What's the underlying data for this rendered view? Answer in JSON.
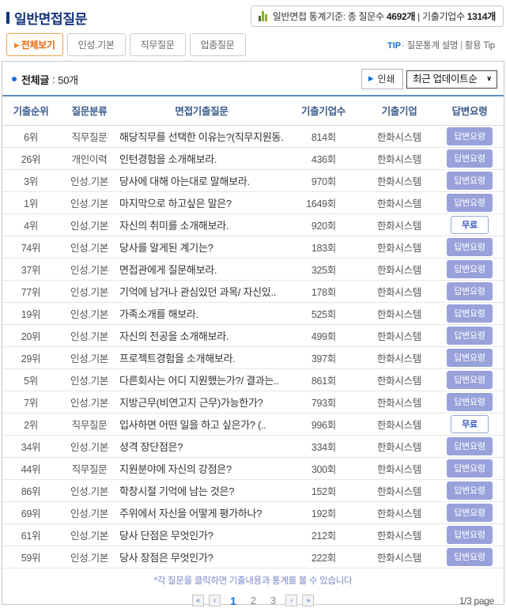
{
  "header": {
    "title": "일반면접질문",
    "stats": {
      "icon": "bar-chart-icon",
      "prefix": "일반면접 통계기준: 총 질문수",
      "question_count": "4692개",
      "separator": "|",
      "mid_label": "기출기업수",
      "company_count": "1314개"
    }
  },
  "tabs": [
    {
      "label": "전체보기",
      "active": true
    },
    {
      "label": "인성.기본",
      "active": false
    },
    {
      "label": "직무질문",
      "active": false
    },
    {
      "label": "업종질문",
      "active": false
    }
  ],
  "tip": {
    "label": "TIP",
    "bullet": "·",
    "link1": "질문통계 설명",
    "separator": "|",
    "link2": "활용 Tip"
  },
  "toolbar": {
    "total_label": "전체글",
    "colon": ":",
    "total_count": "50개",
    "print_label": "인쇄",
    "print_arrow": "▶",
    "sort_selected": "최근 업데이트순"
  },
  "table": {
    "columns": [
      "기출순위",
      "질문분류",
      "면접기출질문",
      "기출기업수",
      "기출기업",
      "답변요령"
    ],
    "rows": [
      {
        "rank": "6위",
        "category": "직무질문",
        "question": "해당직무를 선택한 이유는?(직무지원동..",
        "count": "814회",
        "company": "한화시스템",
        "action": "답변요령",
        "action_type": "badge"
      },
      {
        "rank": "26위",
        "category": "개인이력",
        "question": "인턴경험을 소개해보라.",
        "count": "436회",
        "company": "한화시스템",
        "action": "답변요령",
        "action_type": "badge"
      },
      {
        "rank": "3위",
        "category": "인성.기본",
        "question": "당사에 대해 아는대로 말해보라.",
        "count": "970회",
        "company": "한화시스템",
        "action": "답변요령",
        "action_type": "badge"
      },
      {
        "rank": "1위",
        "category": "인성.기본",
        "question": "마지막으로 하고싶은 말은?",
        "count": "1649회",
        "company": "한화시스템",
        "action": "답변요령",
        "action_type": "badge"
      },
      {
        "rank": "4위",
        "category": "인성.기본",
        "question": "자신의 취미를 소개해보라.",
        "count": "920회",
        "company": "한화시스템",
        "action": "무료",
        "action_type": "free"
      },
      {
        "rank": "74위",
        "category": "인성.기본",
        "question": "당사를 알게된 계기는?",
        "count": "183회",
        "company": "한화시스템",
        "action": "답변요령",
        "action_type": "badge"
      },
      {
        "rank": "37위",
        "category": "인성.기본",
        "question": "면접관에게 질문해보라.",
        "count": "325회",
        "company": "한화시스템",
        "action": "답변요령",
        "action_type": "badge"
      },
      {
        "rank": "77위",
        "category": "인성.기본",
        "question": "기억에 남거나 관심있던 과목/ 자신있..",
        "count": "178회",
        "company": "한화시스템",
        "action": "답변요령",
        "action_type": "badge"
      },
      {
        "rank": "19위",
        "category": "인성.기본",
        "question": "가족소개를 해보라.",
        "count": "525회",
        "company": "한화시스템",
        "action": "답변요령",
        "action_type": "badge"
      },
      {
        "rank": "20위",
        "category": "인성.기본",
        "question": "자신의 전공을 소개해보라.",
        "count": "499회",
        "company": "한화시스템",
        "action": "답변요령",
        "action_type": "badge"
      },
      {
        "rank": "29위",
        "category": "인성.기본",
        "question": "프로젝트경험을 소개해보라.",
        "count": "397회",
        "company": "한화시스템",
        "action": "답변요령",
        "action_type": "badge"
      },
      {
        "rank": "5위",
        "category": "인성.기본",
        "question": "다른회사는 어디 지원했는가?/ 결과는..",
        "count": "861회",
        "company": "한화시스템",
        "action": "답변요령",
        "action_type": "badge"
      },
      {
        "rank": "7위",
        "category": "인성.기본",
        "question": "지방근무(비연고지 근무)가능한가?",
        "count": "793회",
        "company": "한화시스템",
        "action": "답변요령",
        "action_type": "badge"
      },
      {
        "rank": "2위",
        "category": "직무질문",
        "question": "입사하면 어떤 일을 하고 싶은가? (..",
        "count": "996회",
        "company": "한화시스템",
        "action": "무료",
        "action_type": "free"
      },
      {
        "rank": "34위",
        "category": "인성.기본",
        "question": "성격 장단점은?",
        "count": "334회",
        "company": "한화시스템",
        "action": "답변요령",
        "action_type": "badge"
      },
      {
        "rank": "44위",
        "category": "직무질문",
        "question": "지원분야에 자신의 강점은?",
        "count": "300회",
        "company": "한화시스템",
        "action": "답변요령",
        "action_type": "badge"
      },
      {
        "rank": "86위",
        "category": "인성.기본",
        "question": "학창시절 기억에 남는 것은?",
        "count": "152회",
        "company": "한화시스템",
        "action": "답변요령",
        "action_type": "badge"
      },
      {
        "rank": "69위",
        "category": "인성.기본",
        "question": "주위에서 자신을 어떻게 평가하나?",
        "count": "192회",
        "company": "한화시스템",
        "action": "답변요령",
        "action_type": "badge"
      },
      {
        "rank": "61위",
        "category": "인성.기본",
        "question": "당사 단점은 무엇인가?",
        "count": "212회",
        "company": "한화시스템",
        "action": "답변요령",
        "action_type": "badge"
      },
      {
        "rank": "59위",
        "category": "인성.기본",
        "question": "당사 장점은 무엇인가?",
        "count": "222회",
        "company": "한화시스템",
        "action": "답변요령",
        "action_type": "badge"
      }
    ]
  },
  "footer": {
    "note": "*각 질문을 클릭하면 기출내용과 통계를 볼 수 있습니다",
    "pagination": {
      "first_icon": "«",
      "prev_icon": "‹",
      "pages": [
        "1",
        "2",
        "3"
      ],
      "current": "1",
      "next_icon": "›",
      "last_icon": "»"
    },
    "page_indicator": "1/3 page"
  },
  "colors": {
    "title_navy": "#16337a",
    "accent_blue": "#1a6fd4",
    "tab_orange": "#e8640a",
    "table_header_blue": "#3a5a8c",
    "badge_purple": "#99a1db",
    "note_purple": "#7a86c8",
    "chart_green": "#76b82a"
  }
}
